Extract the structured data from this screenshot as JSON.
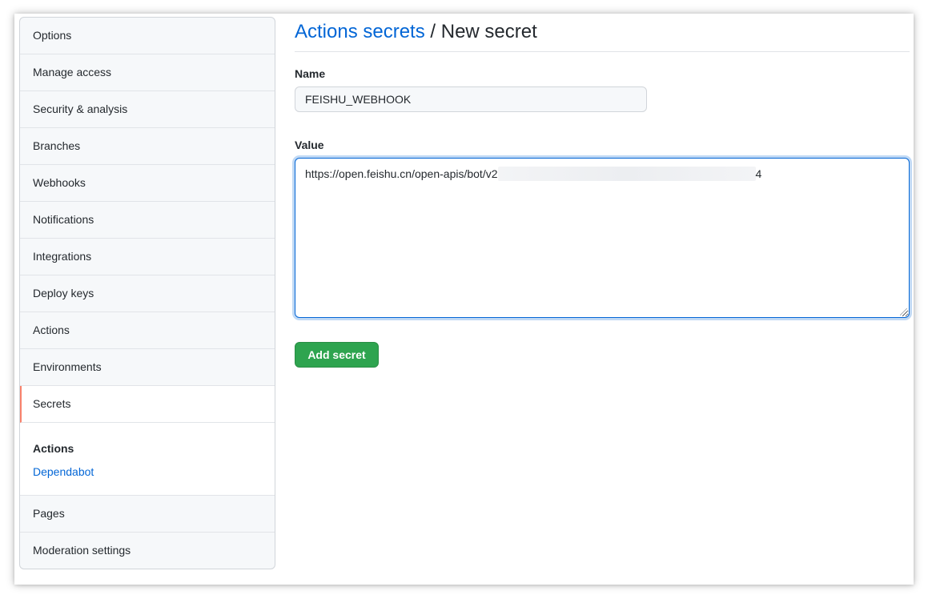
{
  "sidebar": {
    "items_top": [
      {
        "label": "Options"
      },
      {
        "label": "Manage access"
      },
      {
        "label": "Security & analysis"
      },
      {
        "label": "Branches"
      },
      {
        "label": "Webhooks"
      },
      {
        "label": "Notifications"
      },
      {
        "label": "Integrations"
      },
      {
        "label": "Deploy keys"
      },
      {
        "label": "Actions"
      },
      {
        "label": "Environments"
      }
    ],
    "selected": {
      "label": "Secrets"
    },
    "group": {
      "title": "Actions",
      "link": "Dependabot"
    },
    "items_bottom": [
      {
        "label": "Pages"
      },
      {
        "label": "Moderation settings"
      }
    ]
  },
  "header": {
    "breadcrumb_link": "Actions secrets",
    "separator": " / ",
    "current": "New secret"
  },
  "form": {
    "name_label": "Name",
    "name_value": "FEISHU_WEBHOOK",
    "value_label": "Value",
    "value_prefix": "https://open.feishu.cn/open-apis/bot/v2",
    "value_suffix": "4",
    "submit_label": "Add secret"
  },
  "colors": {
    "link": "#0366d6",
    "primary_button": "#2ea44f",
    "selected_indicator": "#f9826c"
  }
}
